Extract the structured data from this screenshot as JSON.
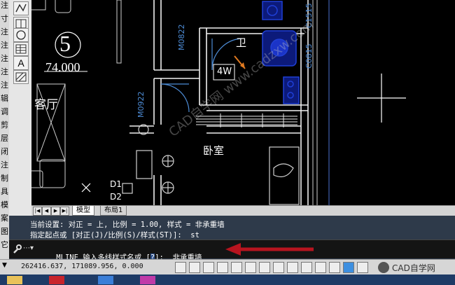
{
  "left_strip": {
    "labels": [
      "注",
      "寸",
      "注",
      "注",
      "注",
      "注",
      "注",
      "辑",
      "调",
      "剪",
      "层",
      "闭",
      "注",
      "制",
      "具",
      "模",
      "案",
      "图",
      "它"
    ]
  },
  "palette": {
    "icons": [
      "polyline-icon",
      "window-icon",
      "circle-icon",
      "table-icon",
      "text-icon",
      "hatch-icon"
    ],
    "text_icon_label": "A"
  },
  "drawing": {
    "circle_number": "5",
    "dimension_value": "74.000",
    "room_label_living": "客厅",
    "room_label_bed": "卧室",
    "room_label_bath": "卫",
    "window_labels": [
      "M0822",
      "M0922"
    ],
    "right_labels": [
      "C1515",
      "C0815"
    ],
    "box_label": "4W",
    "tag_labels": [
      "D1",
      "D2"
    ],
    "watermark": "CAD自学网 www.cadzxw.com"
  },
  "layout_tabs": {
    "model": "模型",
    "layout1": "布局1"
  },
  "command": {
    "line1": "当前设置: 对正 = 上, 比例 = 1.00, 样式 = 非承重墙",
    "line2": "指定起点或 [对正(J)/比例(S)/样式(ST)]:  st",
    "prompt_prefix": "MLINE 输入多线样式名或 [",
    "prompt_option": "?",
    "prompt_suffix": "]:  非承重墙"
  },
  "status_bar": {
    "coordinates": "262416.637, 171089.956, 0.000",
    "brand": "CAD自学网"
  },
  "colors": {
    "canvas_bg": "#000000",
    "wall": "#ffffff",
    "door": "#4d8cd6",
    "furniture": "#1f3fd6",
    "arrow": "#b8141f",
    "command_bg": "#2e3a4a"
  }
}
